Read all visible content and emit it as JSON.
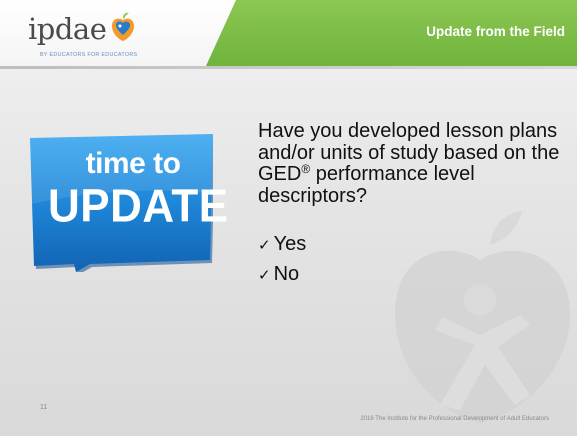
{
  "header": {
    "logo_text": "ipdae",
    "logo_tagline": "BY EDUCATORS FOR EDUCATORS",
    "section_title": "Update from the Field"
  },
  "badge": {
    "line1": "time to",
    "line2": "UPDATE"
  },
  "question": {
    "text": "Have you developed lesson plans and/or units of study based on the GED",
    "registered_mark": "®",
    "text_after": "performance level descriptors?"
  },
  "options": [
    {
      "check": "✓",
      "label": "Yes"
    },
    {
      "check": "✓",
      "label": "No"
    }
  ],
  "footer": {
    "page_number": "11",
    "copyright": "2016 The Institute for the Professional Development of Adult Educators"
  },
  "colors": {
    "header_green": "#7dbd47",
    "badge_blue": "#1b7fd0",
    "text": "#111111"
  },
  "icons": [
    "apple-heart-logo-icon",
    "apple-watermark-icon",
    "checkmark-icon"
  ]
}
